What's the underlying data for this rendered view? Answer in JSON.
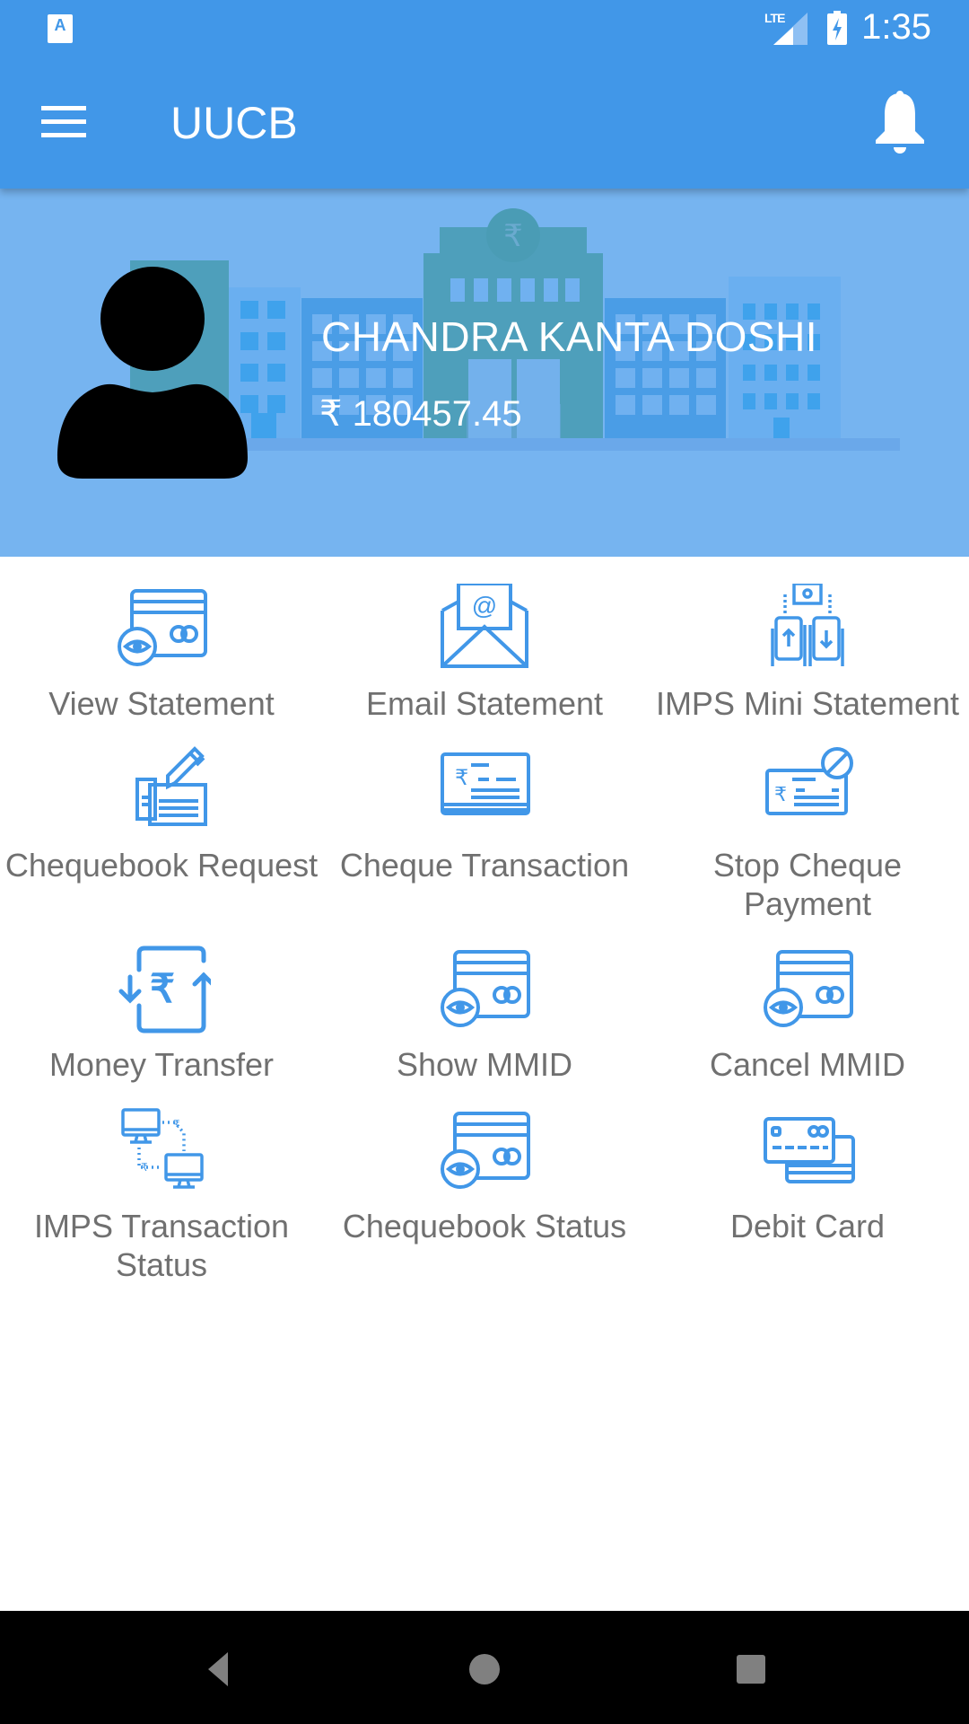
{
  "status_bar": {
    "time": "1:35",
    "network": "LTE",
    "notification_icon": "a-keyboard-icon",
    "lte_label": "LTE",
    "a_label": "A"
  },
  "toolbar": {
    "title": "UUCB",
    "menu_icon": "hamburger-menu-icon",
    "notification_icon": "bell-icon"
  },
  "account": {
    "name": "CHANDRA KANTA DOSHI",
    "balance": "₹ 180457.45"
  },
  "colors": {
    "primary": "#4197e8",
    "banner": "#76b4f0",
    "icon": "#4197e8",
    "label": "#707070"
  },
  "menu": [
    {
      "label": "View Statement",
      "icon": "card-eye-icon"
    },
    {
      "label": "Email Statement",
      "icon": "email-icon"
    },
    {
      "label": "IMPS Mini Statement",
      "icon": "mobile-transfer-icon"
    },
    {
      "label": "Chequebook Request",
      "icon": "cheque-pen-icon"
    },
    {
      "label": "Cheque Transaction",
      "icon": "cheque-book-icon"
    },
    {
      "label": "Stop Cheque Payment",
      "icon": "stop-cheque-icon"
    },
    {
      "label": "Money Transfer",
      "icon": "rupee-transfer-icon"
    },
    {
      "label": "Show MMID",
      "icon": "card-eye-icon"
    },
    {
      "label": "Cancel MMID",
      "icon": "card-eye-icon"
    },
    {
      "label": "IMPS Transaction Status",
      "icon": "computers-transfer-icon"
    },
    {
      "label": "Chequebook Status",
      "icon": "card-eye-icon"
    },
    {
      "label": "Debit Card",
      "icon": "debit-cards-icon"
    }
  ],
  "nav_bar": {
    "back": "back-icon",
    "home": "home-icon",
    "recents": "recents-icon"
  }
}
